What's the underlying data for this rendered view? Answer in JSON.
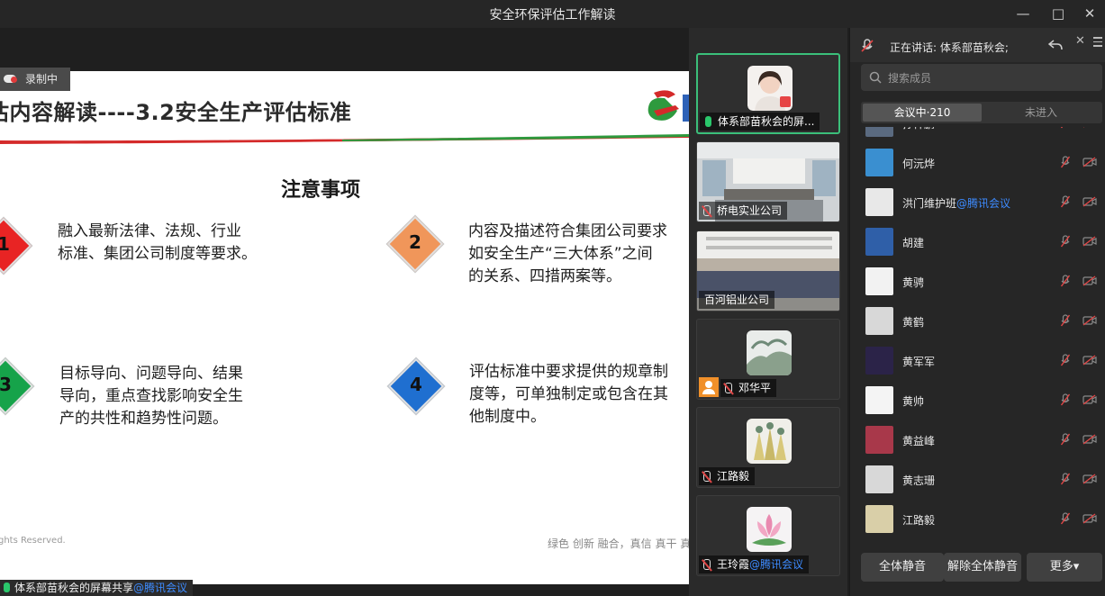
{
  "window": {
    "title": "安全环保评估工作解读"
  },
  "share": {
    "recording_label": "录制中",
    "slide_title": "估内容解读----3.2安全生产评估标准",
    "heading": "注意事项",
    "items": [
      {
        "num": "1",
        "color": "#e82424",
        "lines": [
          "融入最新法律、法规、行业",
          "标准、集团公司制度等要求。"
        ]
      },
      {
        "num": "2",
        "color": "#f0965a",
        "lines": [
          "内容及描述符合集团公司要求",
          "如安全生产“三大体系”之间",
          "的关系、四措两案等。"
        ]
      },
      {
        "num": "3",
        "color": "#16a34a",
        "lines": [
          "目标导向、问题导向、结果",
          "导向，重点查找影响安全生",
          "产的共性和趋势性问题。"
        ]
      },
      {
        "num": "4",
        "color": "#1f6fd0",
        "lines": [
          "评估标准中要求提供的规章制",
          "度等，可单独制定或包含在其",
          "他制度中。"
        ]
      }
    ],
    "footer_left": "ghts Reserved.",
    "footer_right": "绿色 创新 融合，真信 真干 真",
    "caption_main": "体系部苗秋会的屏幕共享",
    "caption_link": "@腾讯会议"
  },
  "videos": [
    {
      "name": "体系部苗秋会的屏...",
      "mic": "on",
      "active": true
    },
    {
      "name": "桥电实业公司",
      "mic": "off",
      "active": false
    },
    {
      "name": "百河铝业公司",
      "mic": "none",
      "active": false
    },
    {
      "name": "邓华平",
      "mic": "off",
      "active": false
    },
    {
      "name": "江路毅",
      "mic": "off",
      "active": false
    },
    {
      "name": "王玲霞",
      "link": "@腾讯会议",
      "mic": "off",
      "active": false
    }
  ],
  "panel": {
    "speaking_label": "正在讲话: 体系部苗秋会;",
    "search_placeholder": "搜索成员",
    "tab_in_meeting": "会议中·210",
    "tab_not_joined": "未进入",
    "members": [
      {
        "name": "孙祥鹏",
        "avatar_color": "#5a6a80"
      },
      {
        "name": "何沅烨",
        "avatar_color": "#3a8fd0"
      },
      {
        "name": "洪门维护班",
        "link": "@腾讯会议",
        "avatar_color": "#e8e8e8"
      },
      {
        "name": "胡建",
        "avatar_color": "#2f5fa8"
      },
      {
        "name": "黄骋",
        "avatar_color": "#f2f2f2"
      },
      {
        "name": "黄鹤",
        "avatar_color": "#d8d8d8"
      },
      {
        "name": "黄军军",
        "avatar_color": "#2b2348"
      },
      {
        "name": "黄帅",
        "avatar_color": "#f4f4f4"
      },
      {
        "name": "黄益峰",
        "avatar_color": "#a8384a"
      },
      {
        "name": "黄志珊",
        "avatar_color": "#d8d8d8"
      },
      {
        "name": "江路毅",
        "avatar_color": "#d9cfa8"
      }
    ],
    "btn_mute_all": "全体静音",
    "btn_unmute_all": "解除全体静音",
    "btn_more": "更多▾"
  }
}
